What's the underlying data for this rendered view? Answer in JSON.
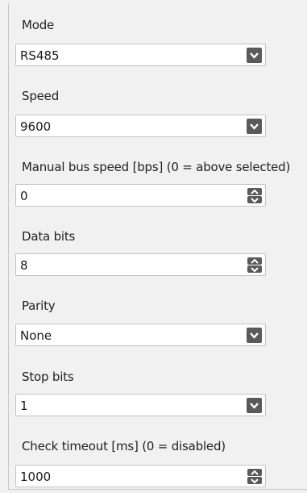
{
  "mode": {
    "label": "Mode",
    "value": "RS485",
    "control": "dropdown",
    "icon": "chevron-down-icon"
  },
  "speed": {
    "label": "Speed",
    "value": "9600",
    "control": "dropdown",
    "icon": "chevron-down-icon"
  },
  "manual_bus_speed": {
    "label": "Manual bus speed [bps] (0 = above selected)",
    "value": "0",
    "control": "spinner"
  },
  "data_bits": {
    "label": "Data bits",
    "value": "8",
    "control": "spinner"
  },
  "parity": {
    "label": "Parity",
    "value": "None",
    "control": "dropdown",
    "icon": "chevron-down-icon"
  },
  "stop_bits": {
    "label": "Stop bits",
    "value": "1",
    "control": "dropdown",
    "icon": "chevron-down-icon"
  },
  "check_timeout": {
    "label": "Check timeout [ms] (0 = disabled)",
    "value": "1000",
    "control": "spinner"
  },
  "colors": {
    "button": "#5a5a5a",
    "panel": "#f1f1f1",
    "field": "#ffffff"
  }
}
